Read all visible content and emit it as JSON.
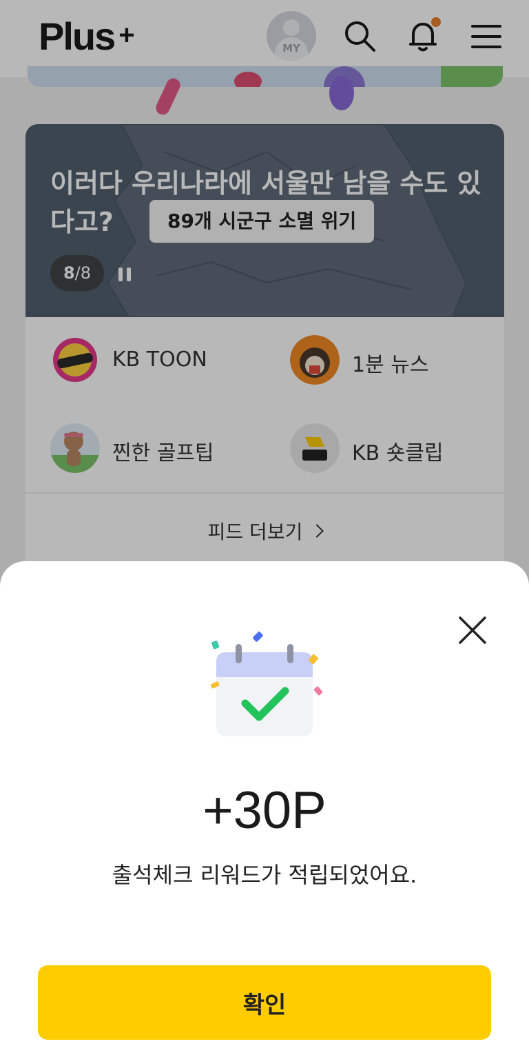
{
  "header": {
    "logo_text": "Plus",
    "logo_plus": "+",
    "avatar_label": "MY",
    "icons": [
      "search-icon",
      "bell-icon",
      "menu-icon"
    ],
    "notification_dot_color": "#e8812e"
  },
  "hero": {
    "title": "이러다 우리나라에 서울만 남을 수도 있다고?",
    "chip": "89개 시군구 소멸 위기",
    "pager_current": "8",
    "pager_total": "/8"
  },
  "shortcuts": [
    {
      "label": "KB TOON",
      "icon": "kb-toon-icon"
    },
    {
      "label": "1분 뉴스",
      "icon": "hedgehog-news-icon"
    },
    {
      "label": "찐한 골프팁",
      "icon": "golf-bear-icon"
    },
    {
      "label": "KB 숏클립",
      "icon": "short-clip-icon"
    }
  ],
  "feed_more": "피드 더보기",
  "reward_sheet": {
    "points": "+30P",
    "message": "출석체크 리워드가 적립되었어요.",
    "confirm_label": "확인",
    "accent_color": "#ffcc00"
  }
}
